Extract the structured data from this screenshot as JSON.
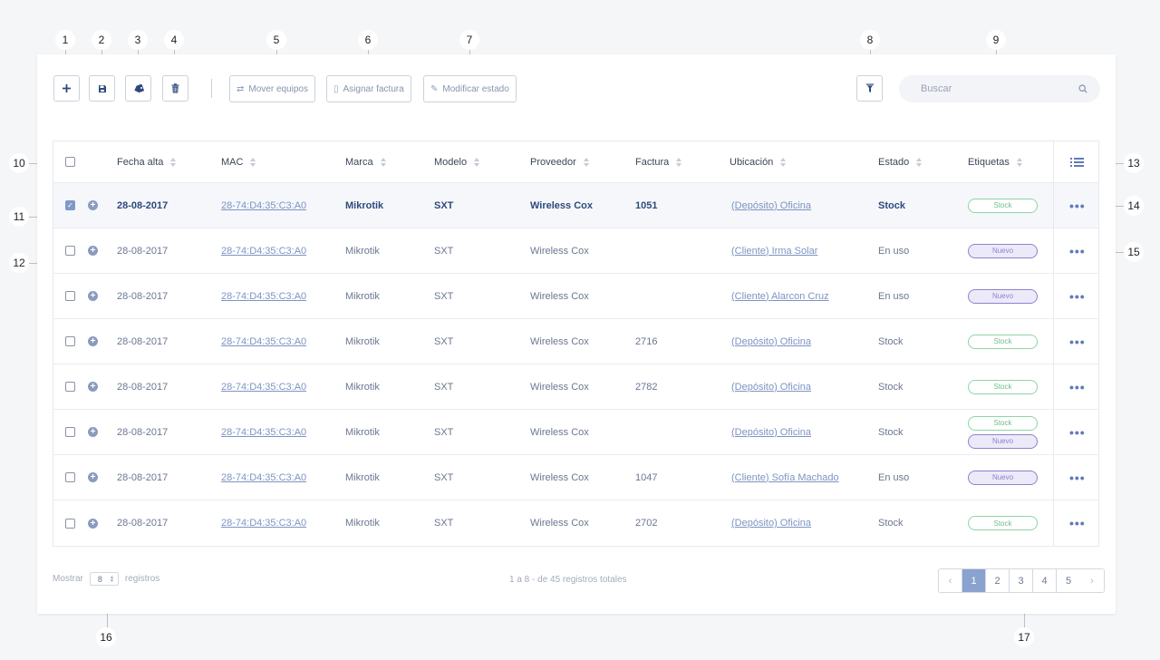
{
  "toolbar": {
    "move_label": "Mover equipos",
    "invoice_label": "Asignar factura",
    "state_label": "Modificar estado",
    "search_placeholder": "Buscar"
  },
  "table": {
    "headers": [
      "Fecha alta",
      "MAC",
      "Marca",
      "Modelo",
      "Proveedor",
      "Factura",
      "Ubicación",
      "Estado",
      "Etiquetas"
    ],
    "rows": [
      {
        "fecha": "28-08-2017",
        "mac": "28-74:D4:35:C3:A0",
        "marca": "Mikrotik",
        "modelo": "SXT",
        "proveedor": "Wireless Cox",
        "factura": "1051",
        "ubicacion": "(Depósito) Oficina",
        "estado": "Stock",
        "tags": [
          "Stock"
        ],
        "selected": true
      },
      {
        "fecha": "28-08-2017",
        "mac": "28-74:D4:35:C3:A0",
        "marca": "Mikrotik",
        "modelo": "SXT",
        "proveedor": "Wireless Cox",
        "factura": "",
        "ubicacion": "(Cliente) Irma Solar",
        "estado": "En uso",
        "tags": [
          "Nuevo"
        ],
        "selected": false
      },
      {
        "fecha": "28-08-2017",
        "mac": "28-74:D4:35:C3:A0",
        "marca": "Mikrotik",
        "modelo": "SXT",
        "proveedor": "Wireless Cox",
        "factura": "",
        "ubicacion": "(Cliente) Alarcon Cruz",
        "estado": "En uso",
        "tags": [
          "Nuevo"
        ],
        "selected": false
      },
      {
        "fecha": "28-08-2017",
        "mac": "28-74:D4:35:C3:A0",
        "marca": "Mikrotik",
        "modelo": "SXT",
        "proveedor": "Wireless Cox",
        "factura": "2716",
        "ubicacion": "(Depósito) Oficina",
        "estado": "Stock",
        "tags": [
          "Stock"
        ],
        "selected": false
      },
      {
        "fecha": "28-08-2017",
        "mac": "28-74:D4:35:C3:A0",
        "marca": "Mikrotik",
        "modelo": "SXT",
        "proveedor": "Wireless Cox",
        "factura": "2782",
        "ubicacion": "(Depósito) Oficina",
        "estado": "Stock",
        "tags": [
          "Stock"
        ],
        "selected": false
      },
      {
        "fecha": "28-08-2017",
        "mac": "28-74:D4:35:C3:A0",
        "marca": "Mikrotik",
        "modelo": "SXT",
        "proveedor": "Wireless Cox",
        "factura": "",
        "ubicacion": "(Depósito) Oficina",
        "estado": "Stock",
        "tags": [
          "Stock",
          "Nuevo"
        ],
        "selected": false
      },
      {
        "fecha": "28-08-2017",
        "mac": "28-74:D4:35:C3:A0",
        "marca": "Mikrotik",
        "modelo": "SXT",
        "proveedor": "Wireless Cox",
        "factura": "1047",
        "ubicacion": "(Cliente) Sofía Machado",
        "estado": "En uso",
        "tags": [
          "Nuevo"
        ],
        "selected": false
      },
      {
        "fecha": "28-08-2017",
        "mac": "28-74:D4:35:C3:A0",
        "marca": "Mikrotik",
        "modelo": "SXT",
        "proveedor": "Wireless Cox",
        "factura": "2702",
        "ubicacion": "(Depósito) Oficina",
        "estado": "Stock",
        "tags": [
          "Stock"
        ],
        "selected": false
      }
    ]
  },
  "footer": {
    "show_label": "Mostrar",
    "per_page": "8",
    "records_label": "registros",
    "summary": "1 a 8 - de 45 registros totales",
    "pages": [
      "1",
      "2",
      "3",
      "4",
      "5"
    ],
    "active_page": "1"
  },
  "callouts": [
    "1",
    "2",
    "3",
    "4",
    "5",
    "6",
    "7",
    "8",
    "9",
    "10",
    "11",
    "12",
    "13",
    "14",
    "15",
    "16",
    "17"
  ],
  "colors": {
    "accent": "#2e4a7a",
    "link": "#7d94c2",
    "stock": "#6cbf89",
    "nuevo": "#8d83cf"
  }
}
